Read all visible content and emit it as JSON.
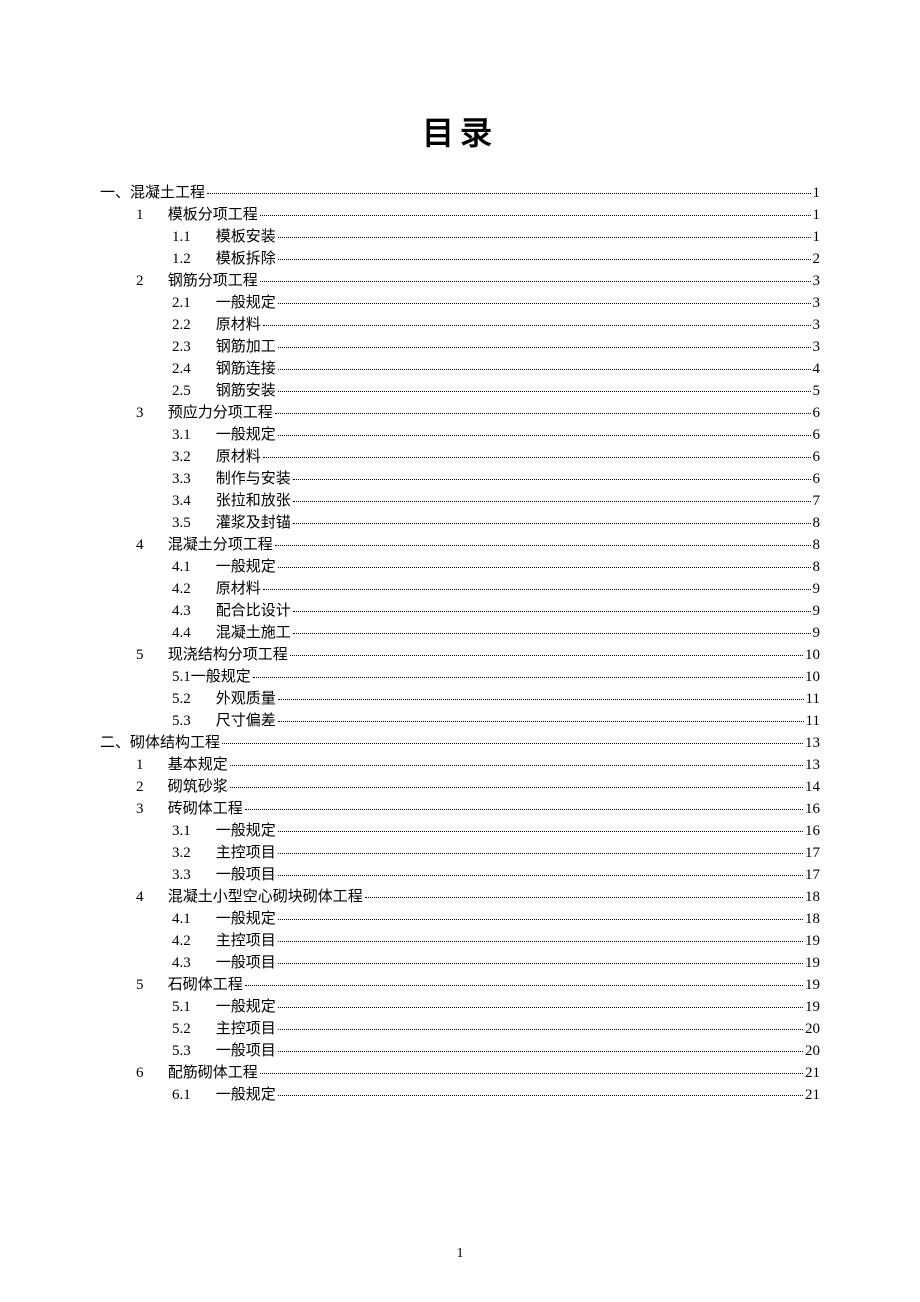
{
  "title": "目录",
  "page_number": "1",
  "toc": [
    {
      "level": 0,
      "num": "一、",
      "text": "混凝土工程",
      "page": "1",
      "nospace": true
    },
    {
      "level": 1,
      "num": "1",
      "text": "模板分项工程",
      "page": "1"
    },
    {
      "level": 2,
      "num": "1.1",
      "text": "模板安装",
      "page": "1"
    },
    {
      "level": 2,
      "num": "1.2",
      "text": "模板拆除",
      "page": "2"
    },
    {
      "level": 1,
      "num": "2",
      "text": "钢筋分项工程",
      "page": "3"
    },
    {
      "level": 2,
      "num": "2.1",
      "text": "一般规定",
      "page": "3"
    },
    {
      "level": 2,
      "num": "2.2",
      "text": "原材料",
      "page": "3"
    },
    {
      "level": 2,
      "num": "2.3",
      "text": "钢筋加工",
      "page": "3"
    },
    {
      "level": 2,
      "num": "2.4",
      "text": "钢筋连接",
      "page": "4"
    },
    {
      "level": 2,
      "num": "2.5",
      "text": "钢筋安装",
      "page": "5"
    },
    {
      "level": 1,
      "num": "3",
      "text": "预应力分项工程",
      "page": "6"
    },
    {
      "level": 2,
      "num": "3.1",
      "text": "一般规定",
      "page": "6"
    },
    {
      "level": 2,
      "num": "3.2",
      "text": "原材料",
      "page": "6"
    },
    {
      "level": 2,
      "num": "3.3",
      "text": "制作与安装",
      "page": "6"
    },
    {
      "level": 2,
      "num": "3.4",
      "text": "张拉和放张",
      "page": "7"
    },
    {
      "level": 2,
      "num": "3.5",
      "text": "灌浆及封锚",
      "page": "8"
    },
    {
      "level": 1,
      "num": "4",
      "text": "混凝土分项工程",
      "page": "8"
    },
    {
      "level": 2,
      "num": "4.1",
      "text": "一般规定",
      "page": "8"
    },
    {
      "level": 2,
      "num": "4.2",
      "text": "原材料",
      "page": "9"
    },
    {
      "level": 2,
      "num": "4.3",
      "text": "配合比设计",
      "page": "9"
    },
    {
      "level": 2,
      "num": "4.4",
      "text": "混凝土施工",
      "page": "9"
    },
    {
      "level": 1,
      "num": "5",
      "text": "现浇结构分项工程",
      "page": "10"
    },
    {
      "level": 2,
      "num": "5.1",
      "text": "一般规定",
      "page": "10",
      "tight": true
    },
    {
      "level": 2,
      "num": "5.2",
      "text": "外观质量",
      "page": "11"
    },
    {
      "level": 2,
      "num": "5.3",
      "text": "尺寸偏差",
      "page": "11"
    },
    {
      "level": 0,
      "num": "二、",
      "text": "砌体结构工程",
      "page": "13",
      "nospace": true
    },
    {
      "level": 1,
      "num": "1",
      "text": "基本规定",
      "page": "13"
    },
    {
      "level": 1,
      "num": "2",
      "text": "砌筑砂浆",
      "page": "14"
    },
    {
      "level": 1,
      "num": "3",
      "text": "砖砌体工程",
      "page": "16"
    },
    {
      "level": 2,
      "num": "3.1",
      "text": "一般规定",
      "page": "16"
    },
    {
      "level": 2,
      "num": "3.2",
      "text": "主控项目",
      "page": "17"
    },
    {
      "level": 2,
      "num": "3.3",
      "text": "一般项目",
      "page": "17"
    },
    {
      "level": 1,
      "num": "4",
      "text": "混凝土小型空心砌块砌体工程",
      "page": "18"
    },
    {
      "level": 2,
      "num": "4.1",
      "text": "一般规定",
      "page": "18"
    },
    {
      "level": 2,
      "num": "4.2",
      "text": "主控项目",
      "page": "19"
    },
    {
      "level": 2,
      "num": "4.3",
      "text": "一般项目",
      "page": "19"
    },
    {
      "level": 1,
      "num": "5",
      "text": "石砌体工程",
      "page": "19"
    },
    {
      "level": 2,
      "num": "5.1",
      "text": "一般规定",
      "page": "19"
    },
    {
      "level": 2,
      "num": "5.2",
      "text": "主控项目",
      "page": "20"
    },
    {
      "level": 2,
      "num": "5.3",
      "text": "一般项目",
      "page": "20"
    },
    {
      "level": 1,
      "num": "6",
      "text": "配筋砌体工程",
      "page": "21"
    },
    {
      "level": 2,
      "num": "6.1",
      "text": "一般规定",
      "page": "21"
    }
  ]
}
